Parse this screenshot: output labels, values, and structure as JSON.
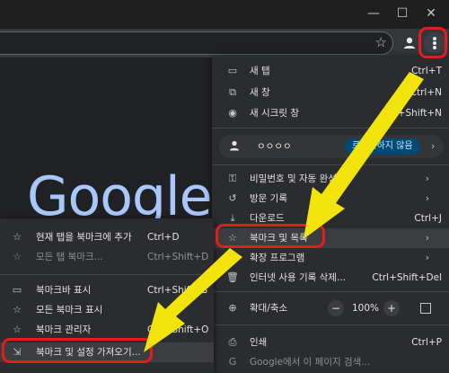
{
  "window": {
    "minimize_glyph": "—",
    "maximize_glyph": "☐",
    "close_glyph": "✕"
  },
  "toolbar": {
    "bookmark_icon": "star-icon",
    "menu_icon": "kebab-menu-icon"
  },
  "page": {
    "logo_text": "Google"
  },
  "main_menu": {
    "items": [
      {
        "icon": "▭",
        "label": "새 탭",
        "shortcut": "Ctrl+T"
      },
      {
        "icon": "⧉",
        "label": "새 창",
        "shortcut": "Ctrl+N"
      },
      {
        "icon": "◉",
        "label": "새 시크릿 창",
        "shortcut": "Ctrl+Shift+N"
      }
    ],
    "profile": {
      "name": "ㅇㅇㅇㅇ",
      "badge": "로그인하지 않음",
      "arrow": "›"
    },
    "items2": [
      {
        "icon": "⚿",
        "label": "비밀번호 및 자동 완성",
        "arrow": "›"
      },
      {
        "icon": "↺",
        "label": "방문 기록",
        "arrow": "›"
      },
      {
        "icon": "⤓",
        "label": "다운로드",
        "shortcut": "Ctrl+J"
      },
      {
        "icon": "☆",
        "label": "북마크 및 목록",
        "arrow": "›"
      },
      {
        "icon": "✦",
        "label": "확장 프로그램",
        "arrow": "›"
      },
      {
        "icon": "🗑",
        "label": "인터넷 사용 기록 삭제...",
        "shortcut": "Ctrl+Shift+Del"
      }
    ],
    "zoom": {
      "icon": "⊕",
      "label": "확대/축소",
      "minus": "−",
      "level": "100%",
      "plus": "+"
    },
    "items3": [
      {
        "icon": "⎙",
        "label": "인쇄",
        "shortcut": "Ctrl+P"
      },
      {
        "icon": "G",
        "label": "Google에서 이 페이지 검색..."
      }
    ]
  },
  "submenu": {
    "items": [
      {
        "icon": "☆",
        "label": "현재 탭을 북마크에 추가",
        "shortcut": "Ctrl+D"
      },
      {
        "icon": "☆",
        "label": "모든 탭 북마크...",
        "shortcut": "Ctrl+Shift+D"
      },
      {
        "icon": "▭",
        "label": "북마크바 표시",
        "shortcut": "Ctrl+Shift+B"
      },
      {
        "icon": "☆",
        "label": "모든 북마크 표시"
      },
      {
        "icon": "☆",
        "label": "북마크 관리자",
        "shortcut": "Ctrl+Shift+O"
      },
      {
        "icon": "⇲",
        "label": "북마크 및 설정 가져오기..."
      }
    ]
  },
  "colors": {
    "highlight_red": "#e11d1d",
    "arrow_yellow": "#f2e30c"
  }
}
